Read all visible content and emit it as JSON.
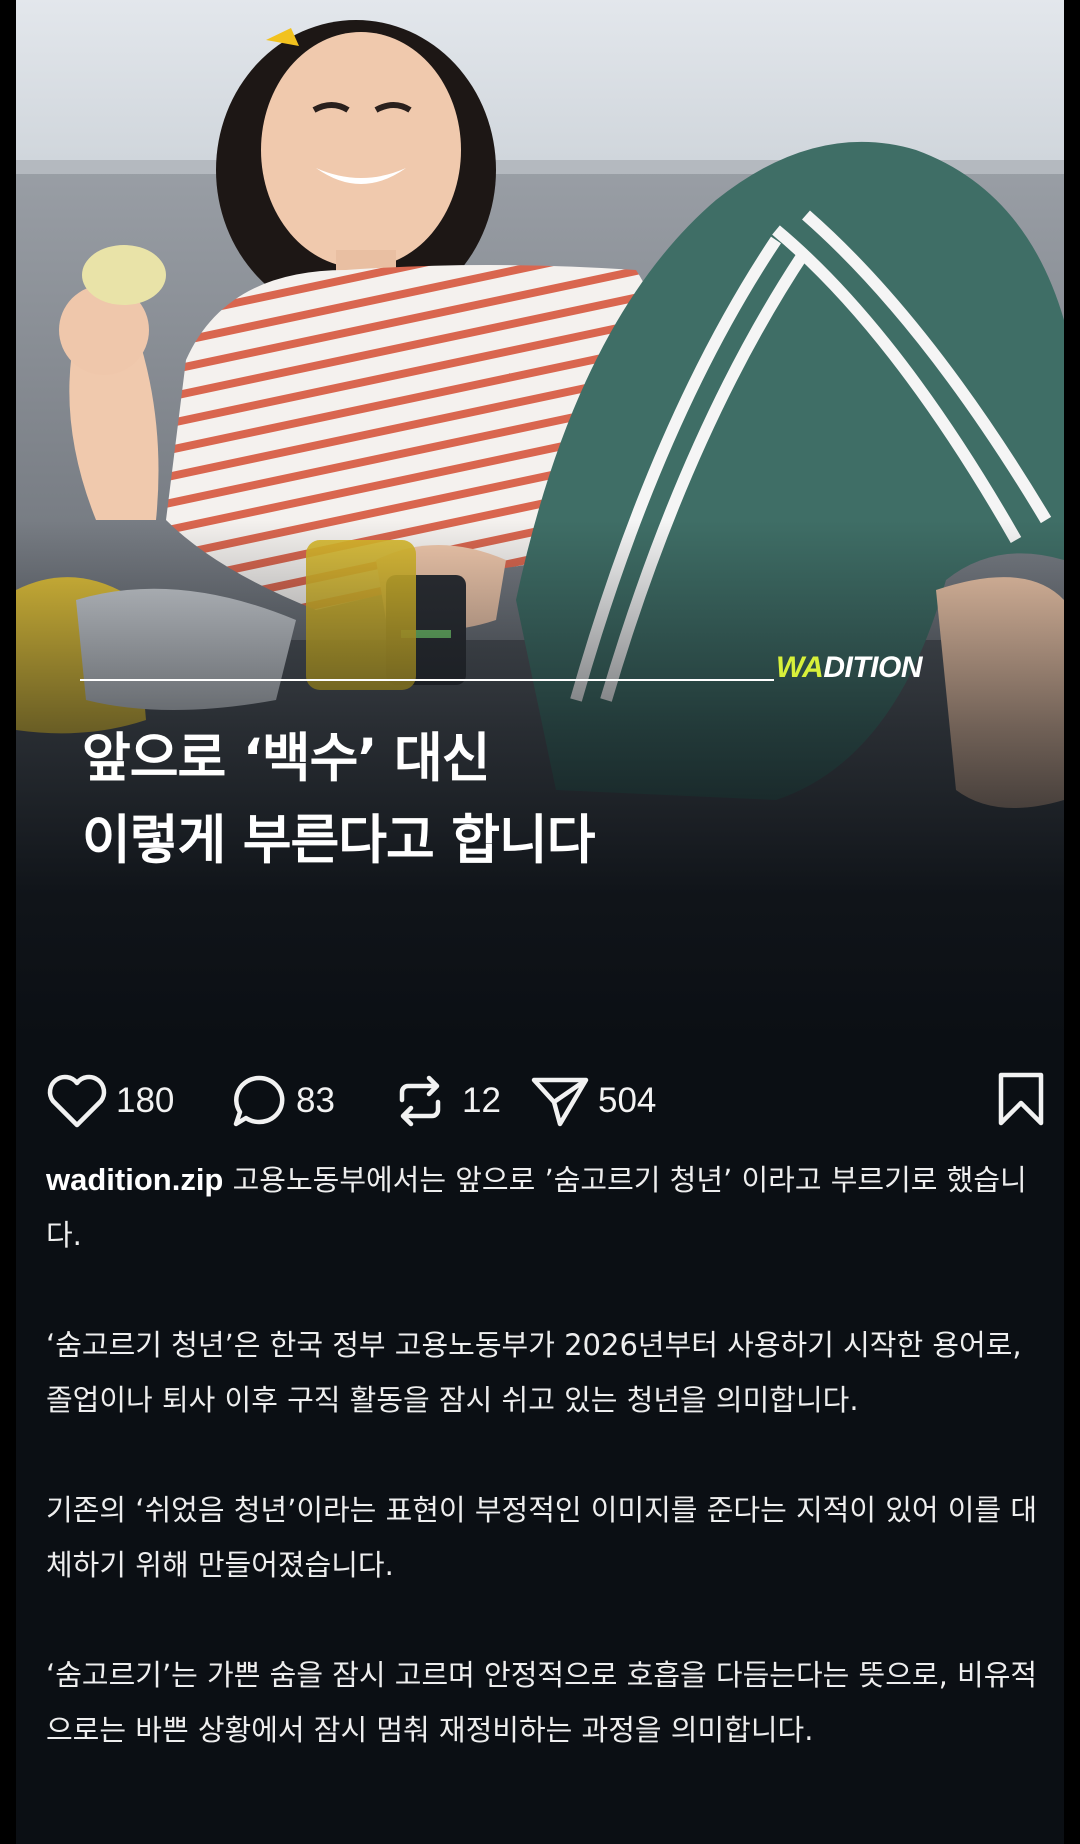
{
  "post": {
    "brand": {
      "prefix": "WA",
      "rest": "DITION",
      "accent_color": "#d8f03a"
    },
    "headline": {
      "line1": "앞으로 ‘백수’ 대신",
      "line2": "이렇게 부른다고 합니다"
    },
    "actions": {
      "likes": "180",
      "comments": "83",
      "reposts": "12",
      "shares": "504"
    },
    "caption": {
      "username": "wadition.zip",
      "p1_text": " 고용노동부에서는 앞으로 ’숨고르기 청년’ 이라고 부르기로 했습니다.",
      "p2": "‘숨고르기 청년’은 한국 정부 고용노동부가 2026년부터 사용하기 시작한 용어로, 졸업이나 퇴사 이후 구직 활동을 잠시 쉬고 있는 청년을 의미합니다.",
      "p3": "기존의 ‘쉬었음 청년’이라는 표현이 부정적인 이미지를 준다는 지적이 있어 이를 대체하기 위해 만들어졌습니다.",
      "p4": "‘숨고르기’는 가쁜 숨을 잠시 고르며 안정적으로 호흡을 다듬는다는 뜻으로, 비유적으로는 바쁜 상황에서 잠시 멈춰 재정비하는 과정을 의미합니다."
    }
  },
  "icons": [
    "heart-icon",
    "comment-icon",
    "repost-icon",
    "send-icon",
    "bookmark-icon"
  ],
  "colors": {
    "background": "#0b0f14",
    "text": "#f2f2f2"
  }
}
